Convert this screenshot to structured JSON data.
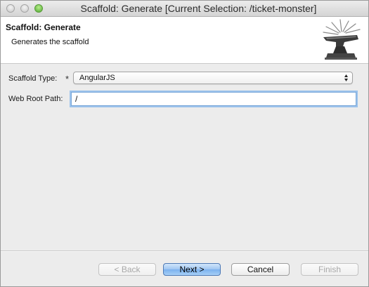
{
  "window": {
    "title": "Scaffold: Generate [Current Selection: /ticket-monster]"
  },
  "banner": {
    "title": "Scaffold: Generate",
    "description": "Generates the scaffold",
    "icon": "anvil-icon"
  },
  "form": {
    "scaffold_type": {
      "label": "Scaffold Type:",
      "required_marker": "*",
      "selected": "AngularJS"
    },
    "web_root_path": {
      "label": "Web Root Path:",
      "value": "/"
    }
  },
  "buttons": {
    "back": "< Back",
    "next": "Next >",
    "cancel": "Cancel",
    "finish": "Finish"
  },
  "colors": {
    "window_bg": "#ececec",
    "banner_bg": "#ffffff",
    "default_button": "#7ab1ee",
    "focus_ring": "#9cc3ec"
  }
}
